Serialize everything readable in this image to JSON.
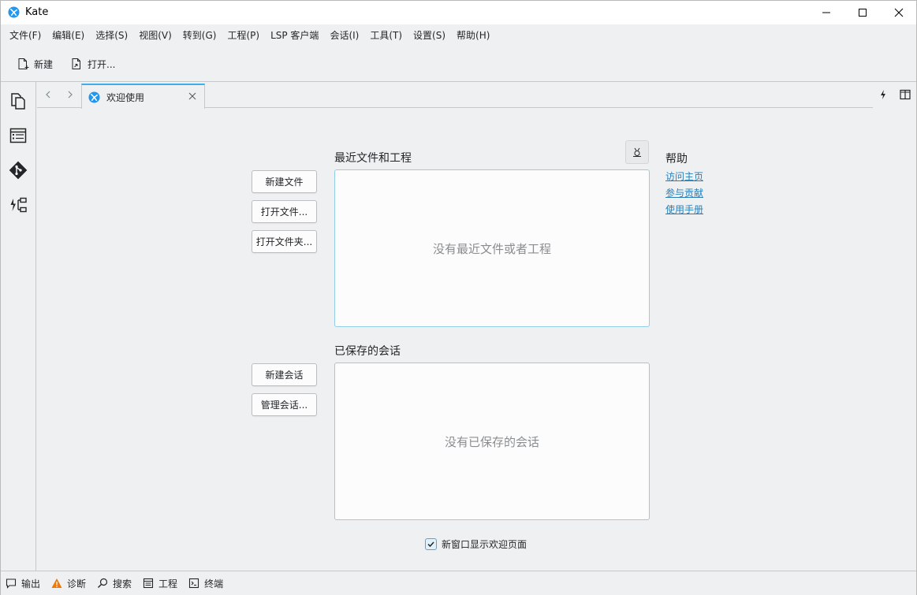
{
  "window": {
    "title": "Kate",
    "accent_color": "#3daee9",
    "link_color": "#2980b9"
  },
  "menubar": {
    "items": [
      {
        "label": "文件(F)"
      },
      {
        "label": "编辑(E)"
      },
      {
        "label": "选择(S)"
      },
      {
        "label": "视图(V)"
      },
      {
        "label": "转到(G)"
      },
      {
        "label": "工程(P)"
      },
      {
        "label": "LSP 客户端"
      },
      {
        "label": "会话(I)"
      },
      {
        "label": "工具(T)"
      },
      {
        "label": "设置(S)"
      },
      {
        "label": "帮助(H)"
      }
    ]
  },
  "toolbar": {
    "new_label": "新建",
    "open_label": "打开..."
  },
  "tabs": [
    {
      "label": "欢迎使用",
      "icon": "kate-logo-icon"
    }
  ],
  "welcome": {
    "recent_title": "最近文件和工程",
    "recent_empty": "没有最近文件或者工程",
    "sessions_title": "已保存的会话",
    "sessions_empty": "没有已保存的会话",
    "buttons": {
      "new_file": "新建文件",
      "open_file": "打开文件...",
      "open_folder": "打开文件夹...",
      "new_session": "新建会话",
      "manage_sessions": "管理会话..."
    },
    "help": {
      "title": "帮助",
      "links": [
        "访问主页",
        "参与贡献",
        "使用手册"
      ]
    },
    "show_on_new_window": {
      "label": "新窗口显示欢迎页面",
      "checked": true
    }
  },
  "bottombar": {
    "items": [
      {
        "label": "输出",
        "icon": "output-icon"
      },
      {
        "label": "诊断",
        "icon": "warning-icon"
      },
      {
        "label": "搜索",
        "icon": "search-icon"
      },
      {
        "label": "工程",
        "icon": "project-icon"
      },
      {
        "label": "终端",
        "icon": "terminal-icon"
      }
    ]
  }
}
